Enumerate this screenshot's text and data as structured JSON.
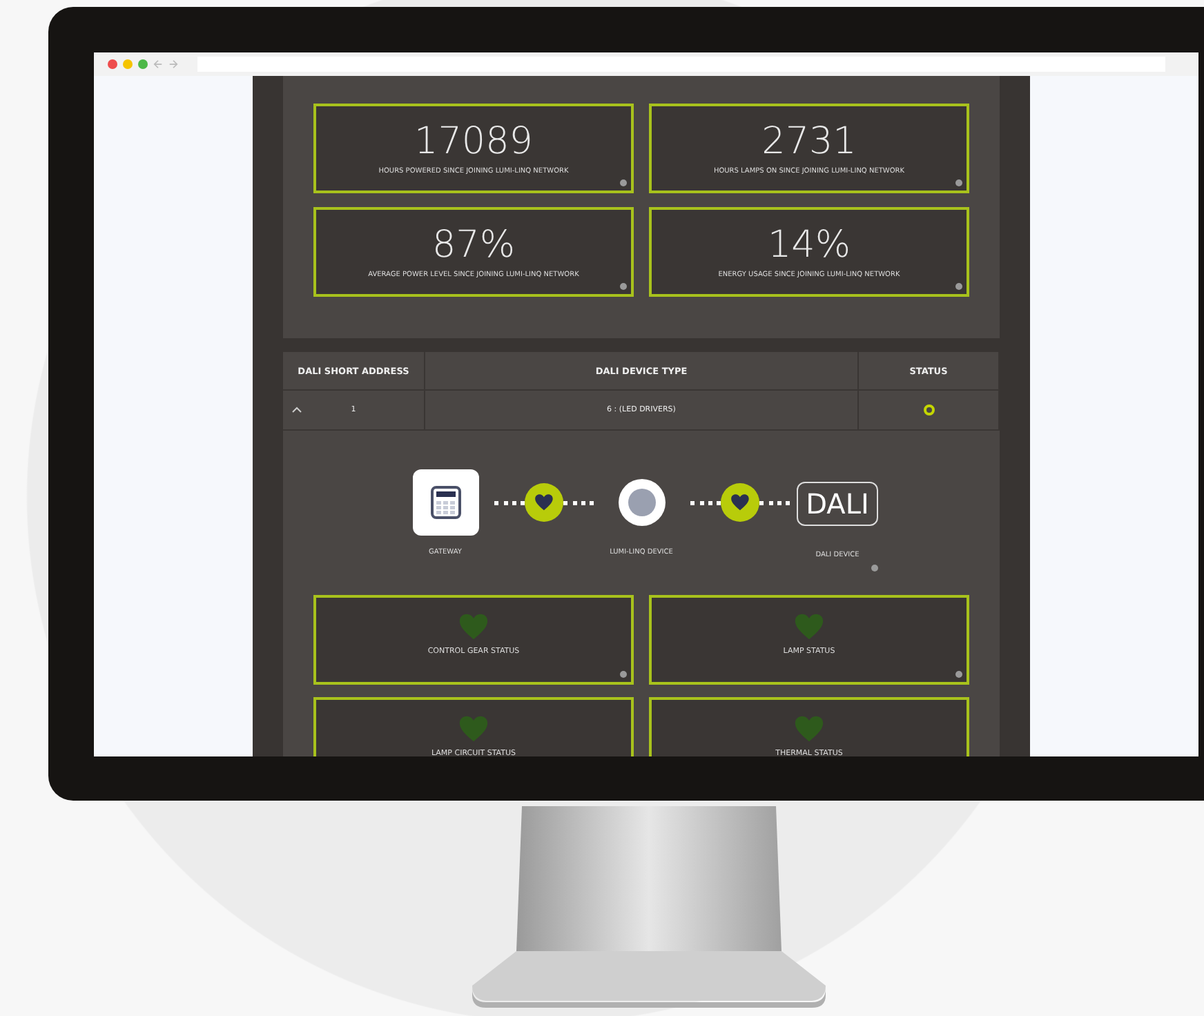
{
  "stats": [
    {
      "value": "17089",
      "label": "HOURS POWERED SINCE JOINING LUMI-LINQ NETWORK"
    },
    {
      "value": "2731",
      "label": "HOURS LAMPS ON SINCE JOINING LUMI-LINQ NETWORK"
    },
    {
      "value": "87%",
      "label": "AVERAGE POWER LEVEL SINCE JOINING LUMI-LINQ NETWORK"
    },
    {
      "value": "14%",
      "label": "ENERGY USAGE SINCE JOINING LUMI-LINQ NETWORK"
    }
  ],
  "table": {
    "columns": [
      "DALI SHORT ADDRESS",
      "DALI DEVICE TYPE",
      "STATUS"
    ],
    "rows": [
      {
        "expanded": true,
        "address": "1",
        "device_type": "6 : (LED DRIVERS)",
        "color": "#c4d600"
      }
    ]
  },
  "diagram": [
    {
      "kind": "gateway",
      "label": "GATEWAY"
    },
    {
      "kind": "heart"
    },
    {
      "kind": "device",
      "label": "LUMI-LINQ DEVICE"
    },
    {
      "kind": "heart"
    },
    {
      "kind": "dali",
      "text": "DALI",
      "label": "DALI DEVICE"
    }
  ],
  "status_cards": [
    {
      "label": "CONTROL GEAR STATUS",
      "color": "#2e5a1c"
    },
    {
      "label": "LAMP STATUS",
      "color": "#2e5a1c"
    },
    {
      "label": "LAMP CIRCUIT STATUS",
      "color": "#2e5a1c"
    },
    {
      "label": "THERMAL STATUS",
      "color": "#2e5a1c"
    }
  ]
}
